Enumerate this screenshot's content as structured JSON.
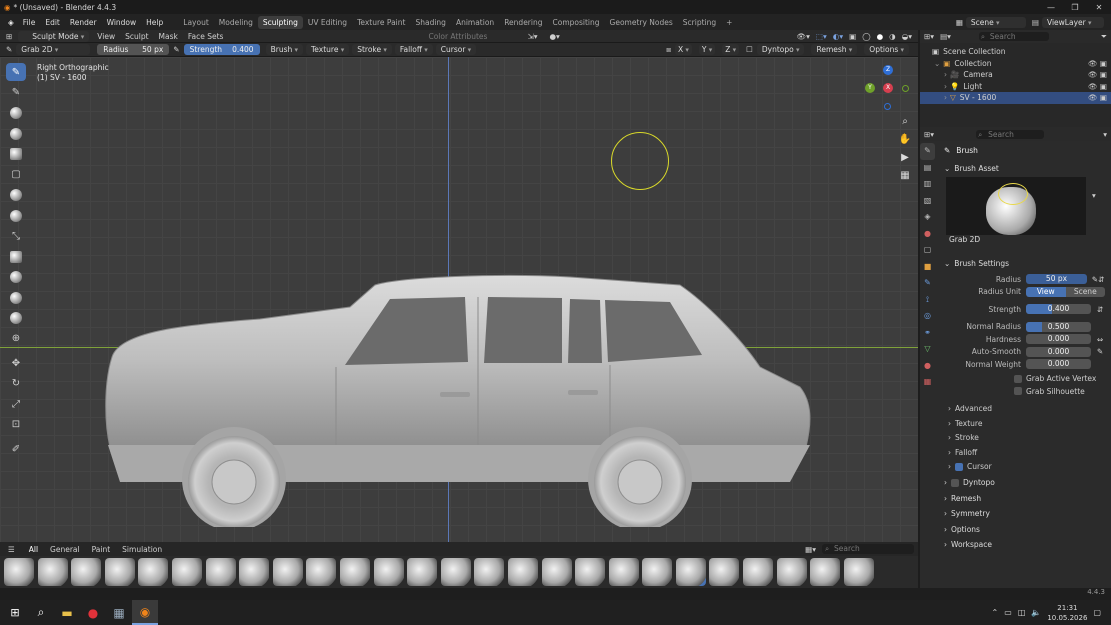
{
  "window": {
    "title": "* (Unsaved) - Blender 4.4.3"
  },
  "menu": {
    "items": [
      "File",
      "Edit",
      "Render",
      "Window",
      "Help"
    ]
  },
  "workspaces": [
    {
      "label": "Layout",
      "active": false
    },
    {
      "label": "Modeling",
      "active": false
    },
    {
      "label": "Sculpting",
      "active": true
    },
    {
      "label": "UV Editing",
      "active": false
    },
    {
      "label": "Texture Paint",
      "active": false
    },
    {
      "label": "Shading",
      "active": false
    },
    {
      "label": "Animation",
      "active": false
    },
    {
      "label": "Rendering",
      "active": false
    },
    {
      "label": "Compositing",
      "active": false
    },
    {
      "label": "Geometry Nodes",
      "active": false
    },
    {
      "label": "Scripting",
      "active": false
    }
  ],
  "topright": {
    "scene": "Scene",
    "view_layer": "ViewLayer"
  },
  "header": {
    "mode": "Sculpt Mode",
    "view": "View",
    "sculpt": "Sculpt",
    "mask": "Mask",
    "face_sets": "Face Sets",
    "color_attributes": "Color Attributes"
  },
  "tool_settings": {
    "brush_name": "Grab 2D",
    "radius_label": "Radius",
    "radius_value": "50 px",
    "strength_label": "Strength",
    "strength_value": "0.400",
    "brush": "Brush",
    "texture": "Texture",
    "stroke": "Stroke",
    "falloff": "Falloff",
    "cursor": "Cursor",
    "x": "X",
    "y": "Y",
    "z": "Z",
    "dyntopo": "Dyntopo",
    "remesh": "Remesh",
    "options": "Options"
  },
  "viewport": {
    "view_name": "Right Orthographic",
    "object_info": "(1) SV - 1600"
  },
  "gizmo": {
    "x": "X",
    "y": "Y",
    "z": "Z"
  },
  "outliner": {
    "search_placeholder": "Search",
    "scene_collection": "Scene Collection",
    "items": [
      {
        "label": "Collection",
        "level": 1,
        "selected": false
      },
      {
        "label": "Camera",
        "level": 2,
        "selected": false
      },
      {
        "label": "Light",
        "level": 2,
        "selected": false
      },
      {
        "label": "SV - 1600",
        "level": 2,
        "selected": true
      }
    ]
  },
  "properties": {
    "search_placeholder": "Search",
    "tab_title": "Brush",
    "brush_asset_header": "Brush Asset",
    "brush_asset_name": "Grab 2D",
    "brush_settings_header": "Brush Settings",
    "radius": {
      "label": "Radius",
      "value": "50 px"
    },
    "radius_unit": {
      "label": "Radius Unit",
      "view": "View",
      "scene": "Scene"
    },
    "strength": {
      "label": "Strength",
      "value": "0.400",
      "fraction": 0.4
    },
    "normal_radius": {
      "label": "Normal Radius",
      "value": "0.500",
      "fraction": 0.25
    },
    "hardness": {
      "label": "Hardness",
      "value": "0.000"
    },
    "auto_smooth": {
      "label": "Auto-Smooth",
      "value": "0.000"
    },
    "normal_weight": {
      "label": "Normal Weight",
      "value": "0.000"
    },
    "grab_active_vertex": "Grab Active Vertex",
    "grab_silhouette": "Grab Silhouette",
    "subpanels": [
      "Advanced",
      "Texture",
      "Stroke",
      "Falloff",
      "Cursor"
    ],
    "panels": [
      "Dyntopo",
      "Remesh",
      "Symmetry",
      "Options",
      "Workspace"
    ]
  },
  "shelf": {
    "tabs": [
      "All",
      "General",
      "Paint",
      "Simulation"
    ],
    "search_placeholder": "Search",
    "brush_count": 26,
    "selected_index": 20
  },
  "status": {
    "version": "4.4.3"
  },
  "taskbar": {
    "time": "21:31",
    "date": "10.05.2026"
  },
  "colors": {
    "accent": "#4772b3",
    "selection": "#334d80",
    "brush_cursor": "#d8d82a"
  }
}
